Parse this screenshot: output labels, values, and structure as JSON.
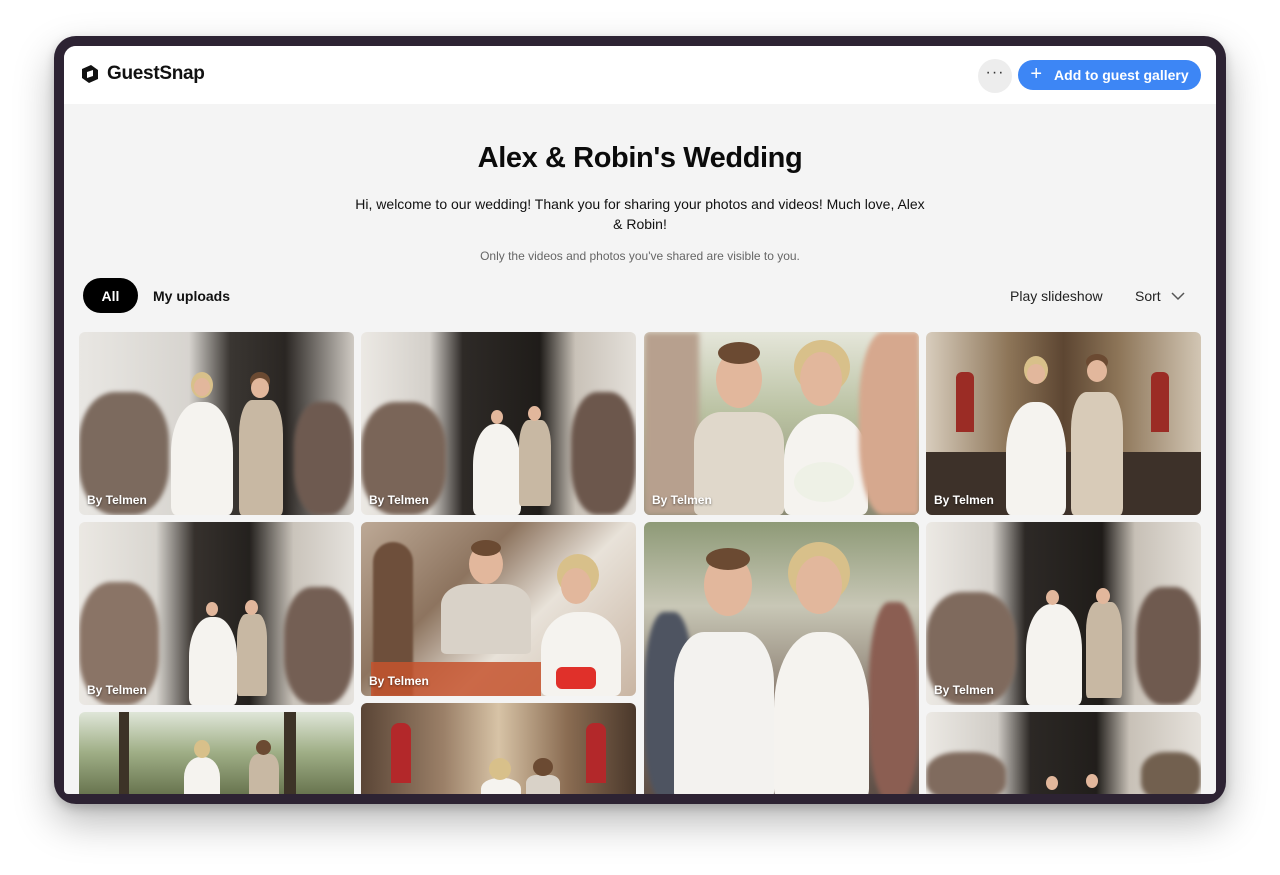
{
  "app": {
    "name": "GuestSnap"
  },
  "header": {
    "more_label": "···",
    "add_label": "Add to guest gallery"
  },
  "event": {
    "title": "Alex & Robin's Wedding",
    "welcome": "Hi, welcome to our wedding! Thank you for sharing your photos and videos! Much love, Alex & Robin!",
    "privacy_note": "Only the videos and photos you've shared are visible to you."
  },
  "filters": {
    "all_label": "All",
    "mine_label": "My uploads",
    "slideshow_label": "Play slideshow",
    "sort_label": "Sort"
  },
  "gallery": [
    {
      "credit": "By Telmen"
    },
    {
      "credit": "By Telmen"
    },
    {
      "credit": "By Telmen"
    },
    {
      "credit": "By Telmen"
    },
    {
      "credit": "By Telmen"
    },
    {
      "credit": "By Telmen"
    },
    {
      "credit": "By Telmen"
    },
    {
      "credit": "By Telmen"
    }
  ],
  "colors": {
    "accent": "#3d86f5",
    "active_tab": "#000000",
    "page_bg": "#f4f4f4"
  }
}
